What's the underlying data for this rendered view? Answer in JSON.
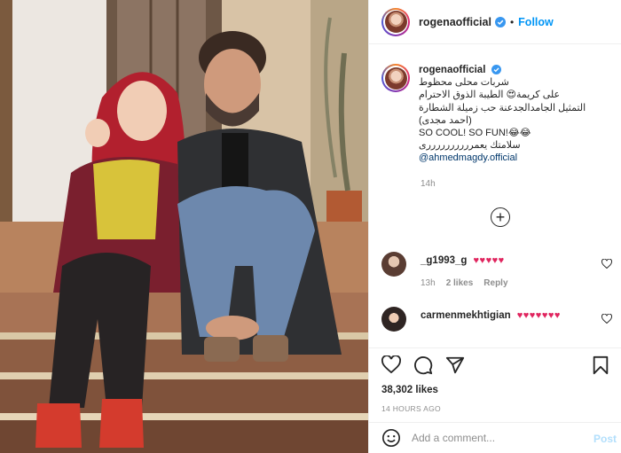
{
  "header": {
    "username": "rogenaofficial",
    "separator": "•",
    "follow_label": "Follow"
  },
  "caption": {
    "username": "rogenaofficial",
    "lines": [
      "شربات محلى محظوط",
      "على كريمة😍 الطيبة الذوق الاحترام",
      "التمثيل الجامدالجدعنة حب زميلة الشطارة",
      "(احمد مجدى)",
      "SO COOL! SO FUN!😂😂",
      "سلامتك يعمررررررررررى"
    ],
    "mention": "@ahmedmagdy.official",
    "time": "14h"
  },
  "comments": [
    {
      "username": "_g1993_g",
      "text": "♥♥♥♥♥",
      "time": "13h",
      "likes": "2 likes",
      "reply_label": "Reply"
    },
    {
      "username": "carmenmekhtigian",
      "text": "♥♥♥♥♥♥♥"
    }
  ],
  "likes_count": "38,302 likes",
  "posted_ago": "14 HOURS AGO",
  "add_comment": {
    "placeholder": "Add a comment...",
    "post_label": "Post"
  },
  "icons": {
    "header_avatar": "avatar",
    "verified": "verified-badge-icon",
    "load_more": "plus-circle-icon",
    "like": "heart-icon",
    "comment": "comment-icon",
    "share": "paper-plane-icon",
    "save": "bookmark-icon",
    "emoji": "smiley-icon"
  },
  "colors": {
    "accent": "#0095f6",
    "mention": "#00376b",
    "hearts": "#e0245e",
    "muted": "#8e8e8e"
  }
}
